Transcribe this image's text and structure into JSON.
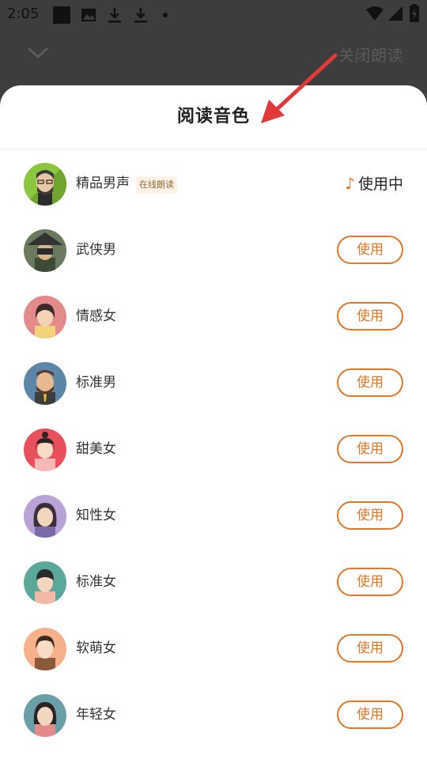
{
  "status_bar": {
    "time": "2:05"
  },
  "header": {
    "close_reading_label": "关闭朗读"
  },
  "sheet": {
    "title": "阅读音色"
  },
  "voices": [
    {
      "name": "精品男声",
      "tag": "在线朗读",
      "status": "使用中"
    },
    {
      "name": "武侠男",
      "button": "使用"
    },
    {
      "name": "情感女",
      "button": "使用"
    },
    {
      "name": "标准男",
      "button": "使用"
    },
    {
      "name": "甜美女",
      "button": "使用"
    },
    {
      "name": "知性女",
      "button": "使用"
    },
    {
      "name": "标准女",
      "button": "使用"
    },
    {
      "name": "软萌女",
      "button": "使用"
    },
    {
      "name": "年轻女",
      "button": "使用"
    }
  ],
  "colors": {
    "accent": "#e07828",
    "overlay": "#3d3d3d",
    "annotation_arrow": "#e0393a"
  },
  "icons": [
    "chevron-down-icon",
    "music-note-icon",
    "wifi-icon",
    "signal-icon",
    "battery-icon",
    "download-icon",
    "image-icon"
  ]
}
